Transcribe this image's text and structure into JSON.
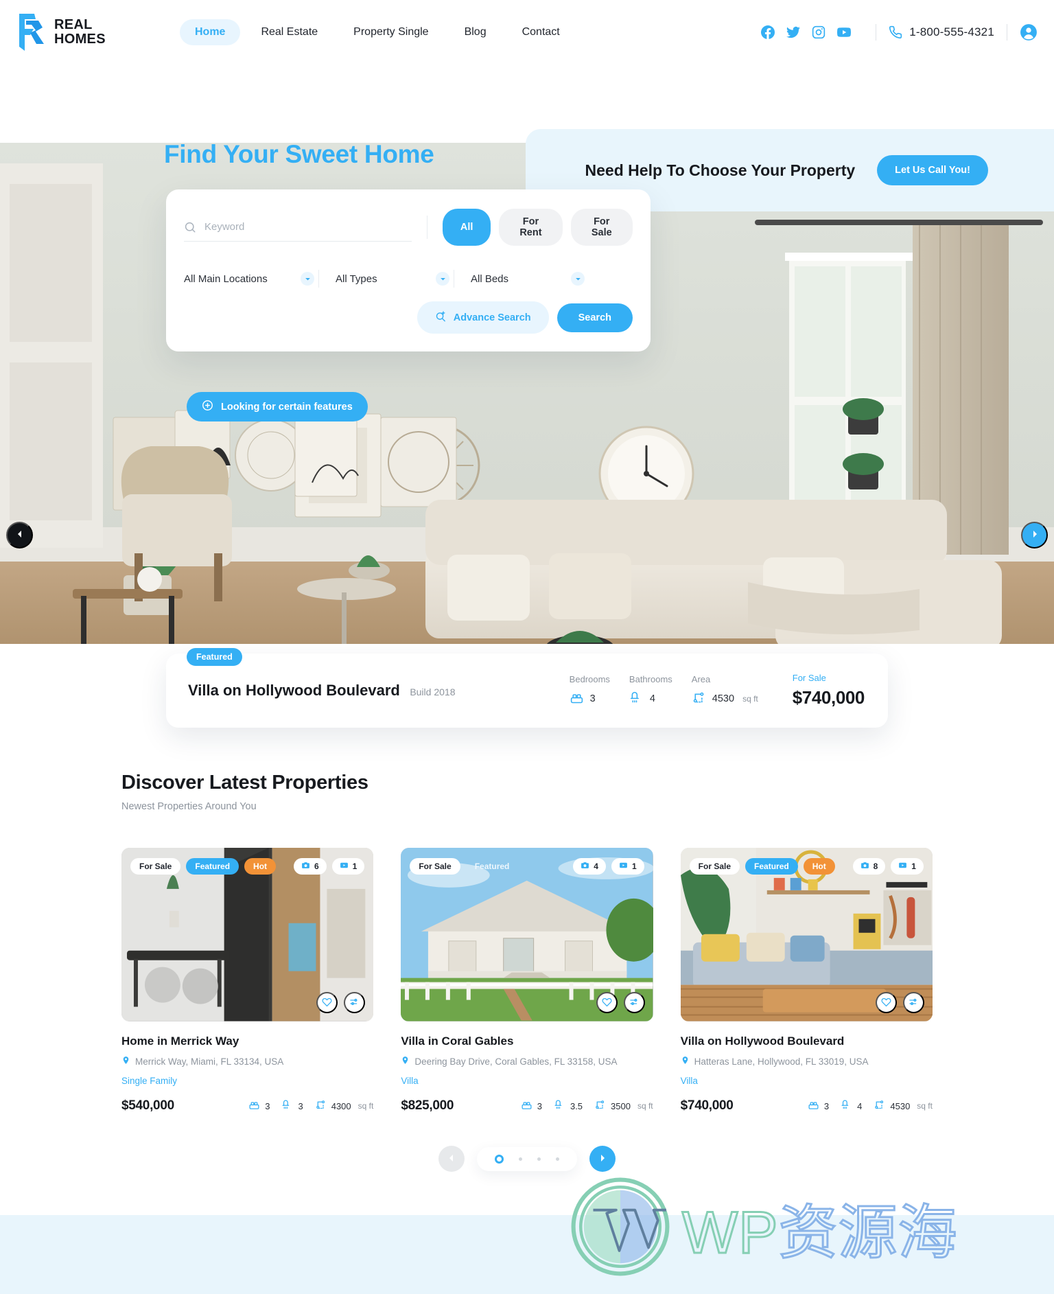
{
  "brand": {
    "line1": "REAL",
    "line2": "HOMES",
    "logo_icon": "realhomes-logo-icon",
    "accent": "#34aff4"
  },
  "nav": {
    "items": [
      {
        "label": "Home",
        "active": true
      },
      {
        "label": "Real Estate",
        "active": false
      },
      {
        "label": "Property Single",
        "active": false
      },
      {
        "label": "Blog",
        "active": false
      },
      {
        "label": "Contact",
        "active": false
      }
    ]
  },
  "header_right": {
    "socials": [
      "facebook-icon",
      "twitter-icon",
      "instagram-icon",
      "youtube-icon"
    ],
    "phone_icon": "phone-icon",
    "phone": "1-800-555-4321",
    "account_icon": "user-account-icon"
  },
  "hero": {
    "title": "Find Your Sweet Home",
    "help_title": "Need Help To Choose Your Property",
    "help_button": "Let Us Call You!",
    "features_badge": "Looking for certain features",
    "prev_icon": "chevron-left-icon",
    "next_icon": "chevron-right-icon"
  },
  "search": {
    "keyword_placeholder": "Keyword",
    "keyword_value": "",
    "search_icon": "search-icon",
    "tabs": [
      {
        "label": "All",
        "active": true
      },
      {
        "label": "For Rent",
        "active": false
      },
      {
        "label": "For Sale",
        "active": false
      }
    ],
    "selects": [
      {
        "label": "All Main Locations"
      },
      {
        "label": "All Types"
      },
      {
        "label": "All Beds"
      }
    ],
    "advance_label": "Advance Search",
    "advance_icon": "search-plus-icon",
    "search_label": "Search"
  },
  "featured_property": {
    "tag": "Featured",
    "name": "Villa on Hollywood Boulevard",
    "build": "Build 2018",
    "specs": [
      {
        "label": "Bedrooms",
        "value": "3",
        "icon": "bed-icon"
      },
      {
        "label": "Bathrooms",
        "value": "4",
        "icon": "shower-icon"
      },
      {
        "label": "Area",
        "value": "4530",
        "unit": "sq ft",
        "icon": "area-icon"
      }
    ],
    "status": "For Sale",
    "price": "$740,000"
  },
  "listings_section": {
    "title": "Discover Latest Properties",
    "subtitle": "Newest Properties Around You"
  },
  "properties": [
    {
      "badges": [
        {
          "label": "For Sale",
          "kind": "sale"
        },
        {
          "label": "Featured",
          "kind": "featured"
        },
        {
          "label": "Hot",
          "kind": "hot"
        }
      ],
      "photo_count": "6",
      "video_count": "1",
      "title": "Home in Merrick Way",
      "address": "Merrick Way, Miami, FL 33134, USA",
      "type": "Single Family",
      "price": "$540,000",
      "beds": "3",
      "baths": "3",
      "area": "4300",
      "area_unit": "sq ft"
    },
    {
      "badges": [
        {
          "label": "For Sale",
          "kind": "sale"
        },
        {
          "label": "Featured",
          "kind": "featured-ghost"
        }
      ],
      "photo_count": "4",
      "video_count": "1",
      "title": "Villa in Coral Gables",
      "address": "Deering Bay Drive, Coral Gables, FL 33158, USA",
      "type": "Villa",
      "price": "$825,000",
      "beds": "3",
      "baths": "3.5",
      "area": "3500",
      "area_unit": "sq ft"
    },
    {
      "badges": [
        {
          "label": "For Sale",
          "kind": "sale"
        },
        {
          "label": "Featured",
          "kind": "featured"
        },
        {
          "label": "Hot",
          "kind": "hot"
        }
      ],
      "photo_count": "8",
      "video_count": "1",
      "title": "Villa on Hollywood Boulevard",
      "address": "Hatteras Lane, Hollywood, FL 33019, USA",
      "type": "Villa",
      "price": "$740,000",
      "beds": "3",
      "baths": "4",
      "area": "4530",
      "area_unit": "sq ft"
    }
  ],
  "card_icons": {
    "favorite": "heart-icon",
    "compare": "compare-icon",
    "location": "map-pin-icon",
    "photos": "camera-icon",
    "videos": "video-icon",
    "bed": "bed-icon",
    "bath": "shower-icon",
    "area": "area-icon"
  },
  "pager": {
    "prev_icon": "chevron-left-icon",
    "next_icon": "chevron-right-icon",
    "dots": 4,
    "active_dot": 0
  },
  "watermark": {
    "text_wp": "WP",
    "text_cn": "资源海",
    "logo_icon": "wordpress-logo-icon"
  }
}
